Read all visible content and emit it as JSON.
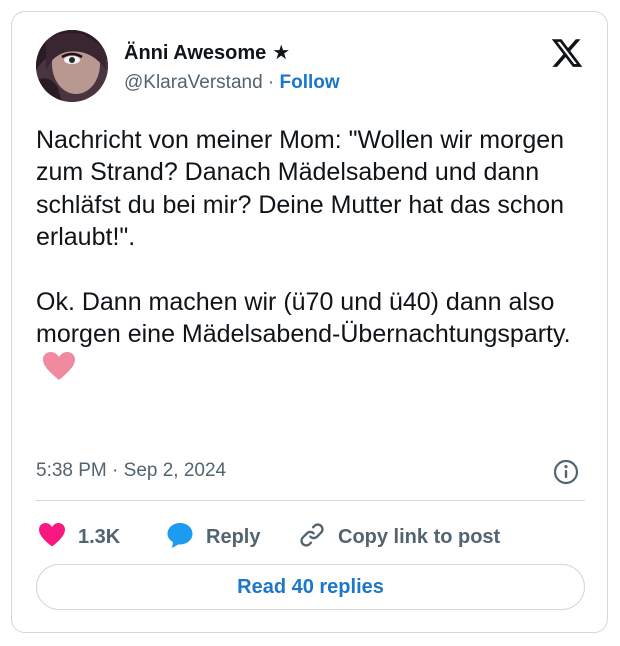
{
  "author": {
    "display_name": "Änni Awesome",
    "badge_glyph": "★",
    "handle": "@KlaraVerstand",
    "separator": "·",
    "follow_label": "Follow"
  },
  "platform_icon": "x-logo-icon",
  "post": {
    "text": "Nachricht von meiner Mom: \"Wollen wir morgen zum Strand? Danach Mädelsabend und dann schläfst du bei mir? Deine Mutter hat das schon erlaubt!\".\n\nOk. Dann machen wir (ü70 und ü40) dann also morgen eine Mädelsabend-Übernachtungsparty.",
    "emoji": "pink-heart-icon",
    "timestamp": "5:38 PM · Sep 2, 2024"
  },
  "actions": {
    "like_count": "1.3K",
    "reply_label": "Reply",
    "copy_label": "Copy link to post"
  },
  "read_replies_label": "Read 40 replies",
  "colors": {
    "accent": "#1d77c9",
    "like": "#f91880",
    "reply": "#1d9bf0",
    "muted": "#536471",
    "border": "#cfd9de",
    "emoji_heart": "#f08aa0"
  }
}
